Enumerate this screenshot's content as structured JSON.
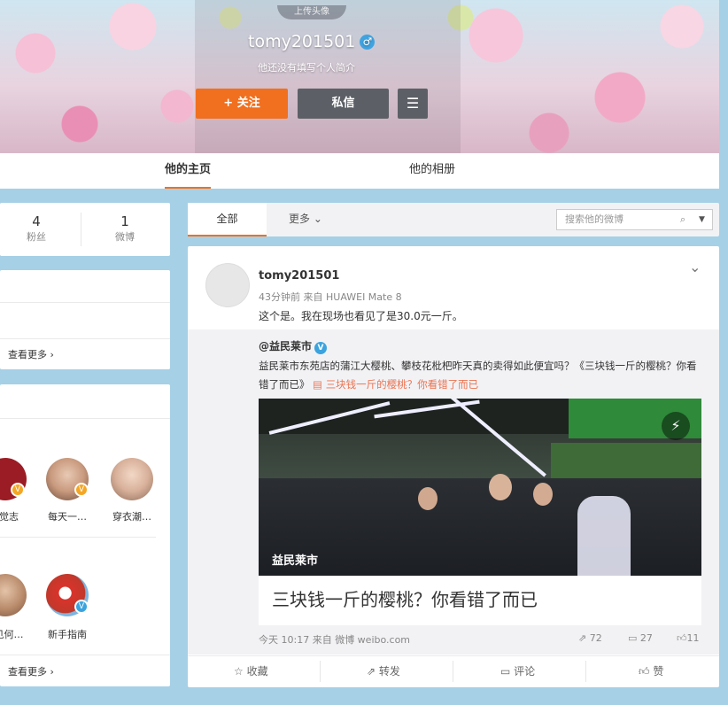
{
  "header": {
    "upload_label": "上传头像",
    "username": "tomy201501",
    "gender_symbol": "♂",
    "bio": "他还没有填写个人简介",
    "follow_label": "+ 关注",
    "message_label": "私信",
    "menu_icon": "hamburger-icon"
  },
  "tabs": {
    "home": "他的主页",
    "album": "他的相册"
  },
  "stats": {
    "fans_count": "4",
    "fans_label": "粉丝",
    "weibo_count": "1",
    "weibo_label": "微博"
  },
  "sidebar": {
    "more_label_1": "查看更多 ›",
    "more_label_2": "查看更多 ›",
    "row1": [
      {
        "label": "觉志"
      },
      {
        "label": "每天一…"
      },
      {
        "label": "穿衣潮…"
      }
    ],
    "row2": [
      {
        "label": "见何…"
      },
      {
        "label": "新手指南"
      }
    ]
  },
  "filter": {
    "all": "全部",
    "more": "更多",
    "search_placeholder": "搜索他的微博"
  },
  "post": {
    "author": "tomy201501",
    "meta": "43分钟前 来自 HUAWEI Mate 8",
    "text": "这个是。我在现场也看见了是30.0元一斤。",
    "repost": {
      "author": "@益民莱市",
      "text": "益民莱市东苑店的蒲江大樱桃、攀枝花枇杷昨天真的卖得如此便宜吗？《三块钱一斤的樱桃？你看错了而已》",
      "link": "三块钱一斤的樱桃？你看错了而已",
      "card_brand": "益民莱市",
      "card_caption": "三块钱一斤的樱桃？你看错了而已",
      "footer_time": "今天 10:17 来自 微博 weibo.com",
      "repost_count": "72",
      "comment_count": "27",
      "like_count": "11"
    },
    "actions": {
      "favorite": "收藏",
      "forward": "转发",
      "comment": "评论",
      "like": "赞"
    }
  },
  "colors": {
    "accent": "#f0701f",
    "background": "#a6d0e6",
    "link": "#eb7350",
    "verified": "#3ba3dd"
  }
}
